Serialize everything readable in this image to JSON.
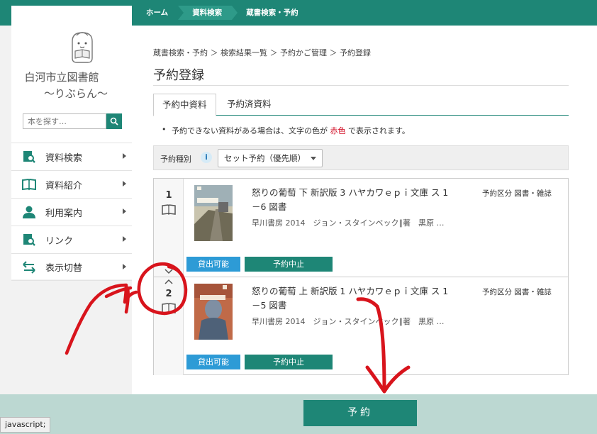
{
  "topnav": {
    "items": [
      "ホーム",
      "資料検索",
      "蔵書検索・予約"
    ]
  },
  "sidebar": {
    "library_name_1": "白河市立図書館",
    "library_name_2": "〜りぶらん〜",
    "search_placeholder": "本を探す…",
    "menu": [
      {
        "label": "資料検索",
        "icon": "search-book-icon"
      },
      {
        "label": "資料紹介",
        "icon": "open-book-icon"
      },
      {
        "label": "利用案内",
        "icon": "person-icon"
      },
      {
        "label": "リンク",
        "icon": "link-icon"
      },
      {
        "label": "表示切替",
        "icon": "swap-arrows-icon"
      }
    ]
  },
  "main": {
    "breadcrumb": "蔵書検索・予約 ＞ 検索結果一覧 ＞ 予約かご管理 ＞ 予約登録",
    "title": "予約登録",
    "tabs": [
      "予約中資料",
      "予約済資料"
    ],
    "note_before": "予約できない資料がある場合は、文字の色が",
    "note_red": "赤色",
    "note_after": "で表示されます。",
    "filter_label": "予約種別",
    "filter_value": "セット予約（優先順）"
  },
  "records": [
    {
      "num": "1",
      "title_line1": "怒りの葡萄 下 新訳版 3 ハヤカワｅｐｉ文庫 ス 1",
      "title_line2": "－6 図書",
      "publisher": "早川書房 2014　ジョン・スタインベック∥著　黒原 …",
      "type": "予約区分 図書・雑誌",
      "available_label": "貸出可能",
      "cancel_label": "予約中止"
    },
    {
      "num": "2",
      "title_line1": "怒りの葡萄 上 新訳版 1 ハヤカワｅｐｉ文庫 ス 1",
      "title_line2": "－5 図書",
      "publisher": "早川書房 2014　ジョン・スタインベック∥著　黒原 …",
      "type": "予約区分 図書・雑誌",
      "available_label": "貸出可能",
      "cancel_label": "予約中止"
    }
  ],
  "footer": {
    "reserve_label": "予約"
  },
  "status_bar": "javascript;",
  "colors": {
    "brand": "#1e8676",
    "available": "#2d9bd6",
    "annotation": "#d8141c"
  }
}
